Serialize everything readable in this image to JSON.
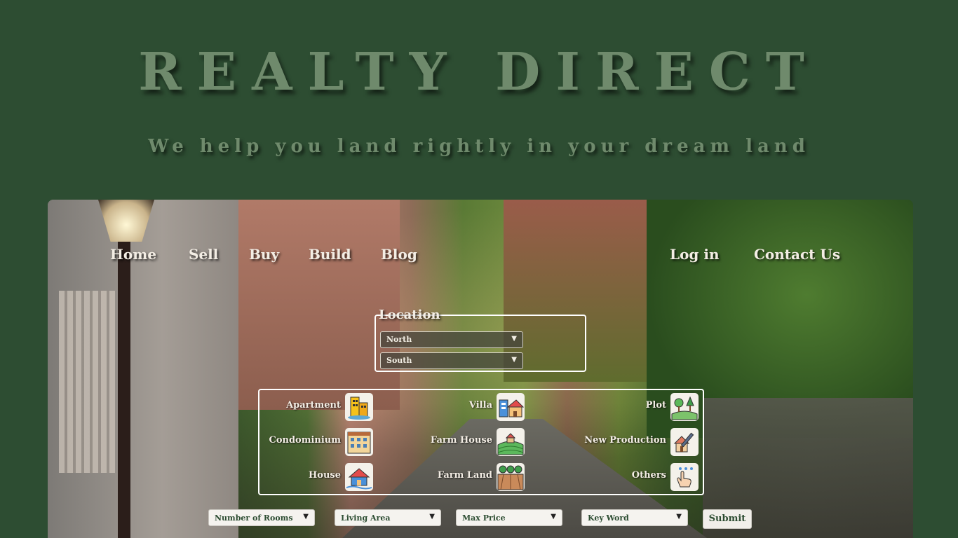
{
  "brand": {
    "title": "REALTY DIRECT",
    "tagline": "We help you land rightly in your dream land"
  },
  "nav": {
    "home": "Home",
    "sell": "Sell",
    "buy": "Buy",
    "build": "Build",
    "blog": "Blog",
    "login": "Log in",
    "contact": "Contact Us"
  },
  "location": {
    "label": "Location",
    "options": [
      "North",
      "South"
    ]
  },
  "property_types": [
    {
      "label": "Apartment",
      "icon": "apartment-building-icon"
    },
    {
      "label": "Villa",
      "icon": "villa-icon"
    },
    {
      "label": "Plot",
      "icon": "plot-icon"
    },
    {
      "label": "Condominium",
      "icon": "condominium-icon"
    },
    {
      "label": "Farm House",
      "icon": "farm-house-icon"
    },
    {
      "label": "New Production",
      "icon": "new-production-icon"
    },
    {
      "label": "House",
      "icon": "house-icon"
    },
    {
      "label": "Farm Land",
      "icon": "farm-land-icon"
    },
    {
      "label": "Others",
      "icon": "pointer-hand-icon"
    }
  ],
  "filters": {
    "rooms": "Number of Rooms",
    "area": "Living Area",
    "price": "Max Price",
    "keyword": "Key Word",
    "submit": "Submit"
  },
  "colors": {
    "background": "#2d4d32",
    "title_text": "#6f8a6c",
    "nav_text": "#f3ede4"
  }
}
